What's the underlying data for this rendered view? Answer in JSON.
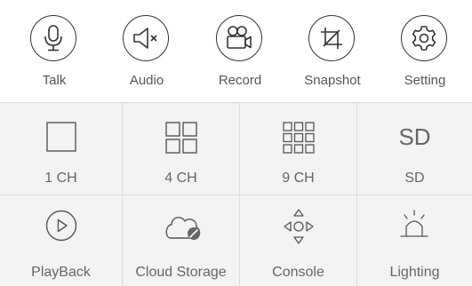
{
  "toolbar": {
    "talk": "Talk",
    "audio": "Audio",
    "record": "Record",
    "snapshot": "Snapshot",
    "setting": "Setting"
  },
  "grid": {
    "ch1": "1 CH",
    "ch4": "4 CH",
    "ch9": "9 CH",
    "sd_icon_text": "SD",
    "sd": "SD",
    "playback": "PlayBack",
    "cloud_storage": "Cloud Storage",
    "console": "Console",
    "lighting": "Lighting"
  },
  "icons": {
    "talk": "microphone-icon",
    "audio": "speaker-muted-icon",
    "record": "video-camera-icon",
    "snapshot": "crop-icon",
    "setting": "gear-icon",
    "ch1": "single-view-icon",
    "ch4": "four-view-icon",
    "ch9": "nine-view-icon",
    "playback": "play-icon",
    "cloud_storage": "cloud-disabled-icon",
    "console": "direction-pad-icon",
    "lighting": "lamp-icon"
  }
}
